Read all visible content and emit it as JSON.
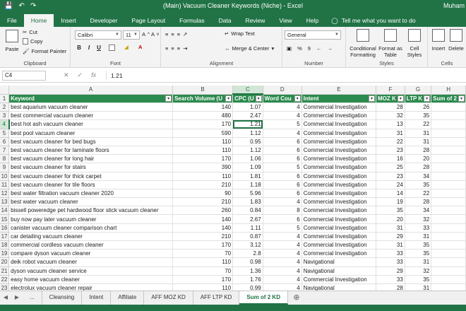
{
  "titlebar": {
    "title": "(Main) Vacuum Cleaner Keywords (Niche)  -  Excel",
    "user": "Muham"
  },
  "ribbon_tabs": [
    "File",
    "Home",
    "Insert",
    "Developer",
    "Page Layout",
    "Formulas",
    "Data",
    "Review",
    "View",
    "Help"
  ],
  "tell_me": "Tell me what you want to do",
  "ribbon": {
    "clipboard": {
      "paste": "Paste",
      "cut": "Cut",
      "copy": "Copy",
      "format_painter": "Format Painter",
      "label": "Clipboard"
    },
    "font": {
      "name": "Calibri",
      "size": "11",
      "bold": "B",
      "italic": "I",
      "underline": "U",
      "label": "Font"
    },
    "alignment": {
      "wrap_text": "Wrap Text",
      "merge_center": "Merge & Center",
      "label": "Alignment"
    },
    "number": {
      "format": "General",
      "percent": "%",
      "comma": "9",
      "label": "Number"
    },
    "styles": {
      "conditional": "Conditional Formatting",
      "format_table": "Format as Table",
      "cell_styles": "Cell Styles",
      "label": "Styles"
    },
    "cells": {
      "insert": "Insert",
      "delete": "Delete",
      "label": "Cells"
    }
  },
  "formula_bar": {
    "name_box": "C4",
    "value": "1.21"
  },
  "column_letters": [
    "A",
    "B",
    "C",
    "D",
    "E",
    "F",
    "G",
    "H"
  ],
  "headers": [
    "Keyword",
    "Search Volume (U",
    "CPC (U",
    "Word Cou",
    "Intent",
    "MOZ K",
    "LTP K",
    "Sum of 2"
  ],
  "rows": [
    [
      "best aquarium vacuum cleaner",
      "140",
      "1.07",
      "4",
      "Commercial Investigation",
      "28",
      "26"
    ],
    [
      "best commercial vacuum cleaner",
      "480",
      "2.47",
      "4",
      "Commercial Investigation",
      "32",
      "35"
    ],
    [
      "best hot ash vacuum cleaner",
      "170",
      "1.21",
      "5",
      "Commercial Investigation",
      "13",
      "22"
    ],
    [
      "best pool vacuum cleaner",
      "590",
      "1.12",
      "4",
      "Commercial Investigation",
      "31",
      "31"
    ],
    [
      "best vacuum cleaner for bed bugs",
      "110",
      "0.95",
      "6",
      "Commercial Investigation",
      "22",
      "31"
    ],
    [
      "best vacuum cleaner for laminate floors",
      "110",
      "1.12",
      "6",
      "Commercial Investigation",
      "23",
      "28"
    ],
    [
      "best vacuum cleaner for long hair",
      "170",
      "1.06",
      "6",
      "Commercial Investigation",
      "16",
      "20"
    ],
    [
      "best vacuum cleaner for stairs",
      "390",
      "1.09",
      "5",
      "Commercial Investigation",
      "25",
      "28"
    ],
    [
      "best vacuum cleaner for thick carpet",
      "110",
      "1.81",
      "6",
      "Commercial Investigation",
      "23",
      "34"
    ],
    [
      "best vacuum cleaner for tile floors",
      "210",
      "1.18",
      "6",
      "Commercial Investigation",
      "24",
      "35"
    ],
    [
      "best water filtration vacuum cleaner 2020",
      "90",
      "5.96",
      "6",
      "Commercial Investigation",
      "14",
      "22"
    ],
    [
      "best water vacuum cleaner",
      "210",
      "1.83",
      "4",
      "Commercial Investigation",
      "19",
      "28"
    ],
    [
      "bissell poweredge pet hardwood floor stick vacuum cleaner",
      "260",
      "0.84",
      "8",
      "Commercial Investigation",
      "35",
      "34"
    ],
    [
      "buy now pay later vacuum cleaner",
      "140",
      "2.67",
      "6",
      "Commercial Investigation",
      "20",
      "32"
    ],
    [
      "canister vacuum cleaner comparison chart",
      "140",
      "1.11",
      "5",
      "Commercial Investigation",
      "31",
      "33"
    ],
    [
      "car detailing vacuum cleaner",
      "210",
      "0.87",
      "4",
      "Commercial Investigation",
      "29",
      "31"
    ],
    [
      "commercial cordless vacuum cleaner",
      "170",
      "3.12",
      "4",
      "Commercial Investigation",
      "31",
      "35"
    ],
    [
      "compare dyson vacuum cleaner",
      "70",
      "2.8",
      "4",
      "Commercial Investigation",
      "33",
      "35"
    ],
    [
      "deik robot vacuum cleaner",
      "110",
      "0.98",
      "4",
      "Navigational",
      "33",
      "31"
    ],
    [
      "dyson vacuum cleaner service",
      "70",
      "1.36",
      "4",
      "Navigational",
      "29",
      "32"
    ],
    [
      "easy home vacuum cleaner",
      "170",
      "1.76",
      "4",
      "Commercial Investigation",
      "33",
      "35"
    ],
    [
      "electrolux vacuum cleaner repair",
      "110",
      "0.99",
      "4",
      "Navigational",
      "28",
      "31"
    ]
  ],
  "row_numbers": [
    "1",
    "2",
    "3",
    "4",
    "5",
    "6",
    "7",
    "8",
    "9",
    "10",
    "11",
    "12",
    "13",
    "14",
    "15",
    "16",
    "17",
    "18",
    "19",
    "20",
    "21",
    "22",
    "23"
  ],
  "sheet_tabs": {
    "ellipsis": "...",
    "tabs": [
      "Cleansing",
      "Intent",
      "Affiliate",
      "AFF MOZ KD",
      "AFF LTP KD",
      "Sum of 2 KD"
    ],
    "active": "Sum of 2 KD"
  }
}
